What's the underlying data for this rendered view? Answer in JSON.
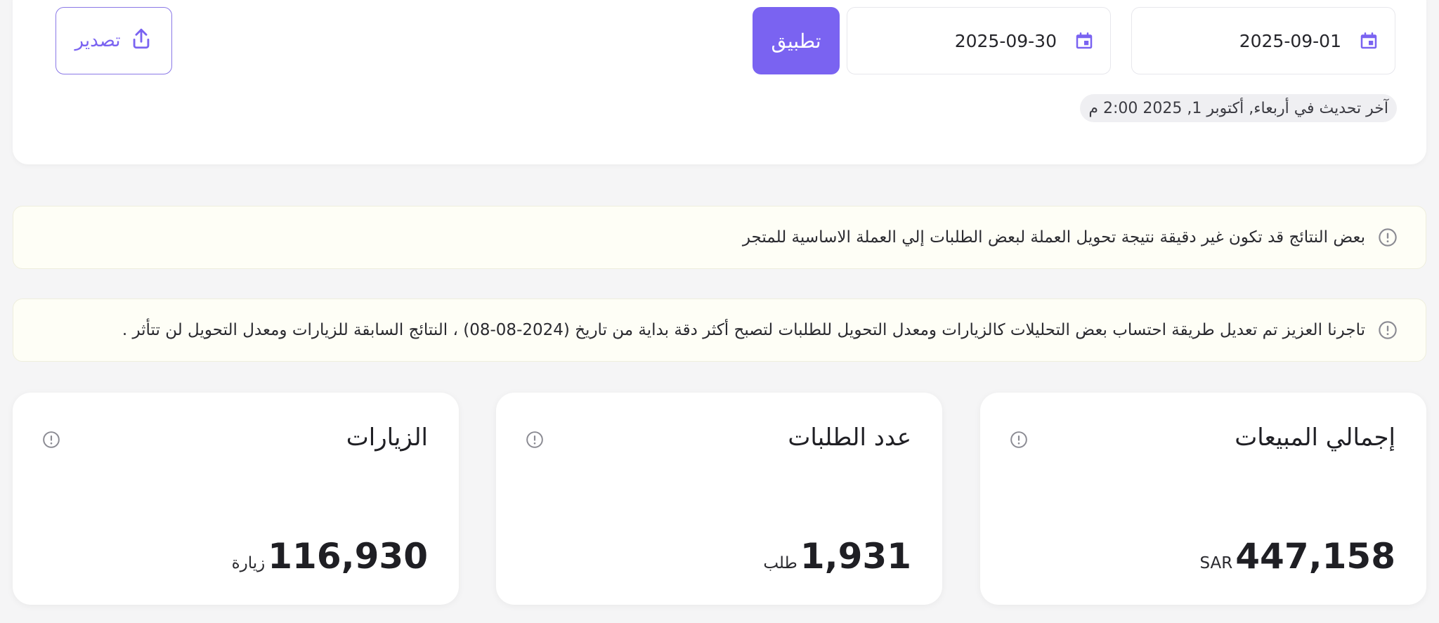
{
  "filters": {
    "start_date": "2025-09-01",
    "end_date": "2025-09-30",
    "apply_label": "تطبيق",
    "export_label": "تصدير",
    "last_updated": "آخر تحديث في أربعاء, أكتوبر 1, 2025 2:00 م"
  },
  "notices": [
    {
      "text": "بعض النتائج قد تكون غير دقيقة نتيجة تحويل العملة لبعض الطلبات إلي العملة الاساسية للمتجر"
    },
    {
      "text": "تاجرنا العزيز تم تعديل طريقة احتساب بعض التحليلات كالزيارات ومعدل التحويل للطلبات لتصبح أكثر دقة بداية من تاريخ (2024-08-08) ، النتائج السابقة للزيارات ومعدل التحويل لن تتأثر ."
    }
  ],
  "stats": [
    {
      "title": "إجمالي المبيعات",
      "value": "447,158",
      "unit": "SAR"
    },
    {
      "title": "عدد الطلبات",
      "value": "1,931",
      "unit": "طلب"
    },
    {
      "title": "الزيارات",
      "value": "116,930",
      "unit": "زيارة"
    }
  ],
  "colors": {
    "accent": "#7a63f1",
    "notice_bg": "#fefef6",
    "page_bg": "#f5f5f6"
  },
  "icons": {
    "calendar": "calendar-icon",
    "export": "upload-icon",
    "info": "info-icon"
  }
}
